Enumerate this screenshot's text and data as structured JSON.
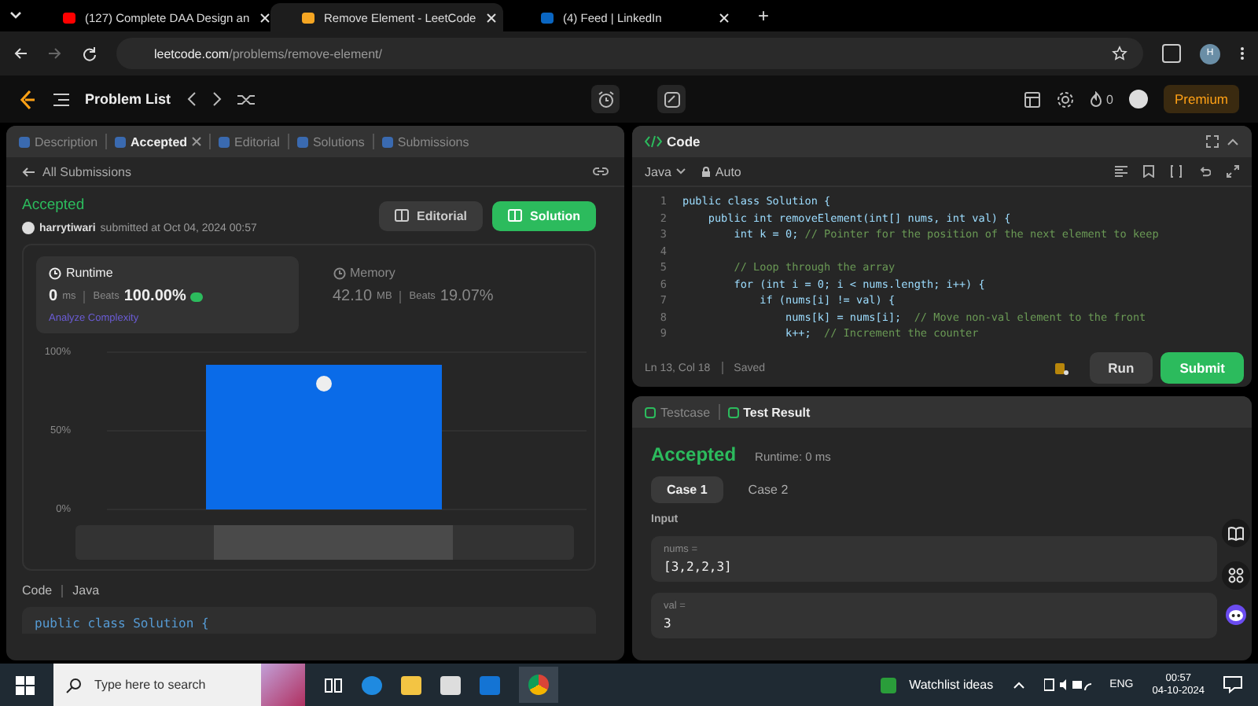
{
  "browser": {
    "tabs": [
      {
        "title": "(127) Complete DAA Design an",
        "kind": "video",
        "selected": false
      },
      {
        "title": "Remove Element - LeetCode",
        "kind": "code",
        "selected": true
      },
      {
        "title": "(4) Feed | LinkedIn",
        "kind": "social",
        "selected": false
      }
    ],
    "new_tab": "+",
    "url_host": "leetcode.com",
    "url_path": "/problems/remove-element/",
    "profile": "H"
  },
  "nav": {
    "title": "Problem List",
    "streak": "0",
    "premium": "Premium"
  },
  "left": {
    "tabs": [
      {
        "label": "Description",
        "selected": false,
        "closable": false
      },
      {
        "label": "Accepted",
        "selected": true,
        "closable": true
      },
      {
        "label": "Editorial",
        "selected": false,
        "closable": false
      },
      {
        "label": "Solutions",
        "selected": false,
        "closable": false
      },
      {
        "label": "Submissions",
        "selected": false,
        "closable": false
      }
    ],
    "back": "All Submissions",
    "status": "Accepted",
    "user": "harrytiwari",
    "submitted": "submitted at Oct 04, 2024 00:57",
    "buttons": [
      {
        "label": "Editorial",
        "kind": "secondary"
      },
      {
        "label": "Solution",
        "kind": "primary"
      }
    ],
    "stats": [
      {
        "title": "Runtime",
        "value": "0",
        "unit": "ms",
        "beats_label": "Beats",
        "beats": "100.00%",
        "selected": true,
        "extra": "Analyze Complexity"
      },
      {
        "title": "Memory",
        "value": "42.10",
        "unit": "MB",
        "beats_label": "Beats",
        "beats": "19.07%",
        "selected": false
      }
    ],
    "chart_data": {
      "type": "bar",
      "categories": [
        null
      ],
      "values": [
        92
      ],
      "ylim": [
        0,
        100
      ],
      "yticks": [
        {
          "value": 0,
          "label": "0%"
        },
        {
          "value": 50,
          "label": "50%"
        },
        {
          "value": 100,
          "label": "100%"
        }
      ]
    },
    "code_label": "Code",
    "code_lang": "Java",
    "code_preview": "public class Solution {"
  },
  "editor": {
    "title": "Code",
    "lang": "Java",
    "mode": "Auto",
    "lines": [
      {
        "n": "1",
        "code": "public class Solution {"
      },
      {
        "n": "2",
        "code": "    public int removeElement(int[] nums, int val) {"
      },
      {
        "n": "3",
        "code": "        int k = 0; ",
        "comment": "// Pointer for the position of the next element to keep"
      },
      {
        "n": "4"
      },
      {
        "n": "5",
        "comment": "        // Loop through the array"
      },
      {
        "n": "6",
        "code": "        for (int i = 0; i < nums.length; i++) {"
      },
      {
        "n": "7",
        "code": "            if (nums[i] != val) {"
      },
      {
        "n": "8",
        "code": "                nums[k] = nums[i];  ",
        "comment": "// Move non-val element to the front"
      },
      {
        "n": "9",
        "code": "                k++;  ",
        "comment": "// Increment the counter"
      }
    ],
    "position": "Ln 13, Col 18",
    "saved": "Saved",
    "run": "Run",
    "submit": "Submit"
  },
  "result": {
    "tabs": [
      {
        "label": "Testcase",
        "selected": false
      },
      {
        "label": "Test Result",
        "selected": true
      }
    ],
    "status": "Accepted",
    "runtime": "Runtime: 0 ms",
    "cases": [
      {
        "label": "Case 1",
        "selected": true
      },
      {
        "label": "Case 2",
        "selected": false
      }
    ],
    "input_label": "Input",
    "inputs": [
      {
        "name": "nums =",
        "value": "[3,2,2,3]"
      },
      {
        "name": "val =",
        "value": "3"
      }
    ]
  },
  "taskbar": {
    "search": {
      "placeholder": "Type here to search"
    },
    "widget": "Watchlist ideas",
    "lang": "ENG",
    "time": "00:57",
    "date": "04-10-2024"
  }
}
